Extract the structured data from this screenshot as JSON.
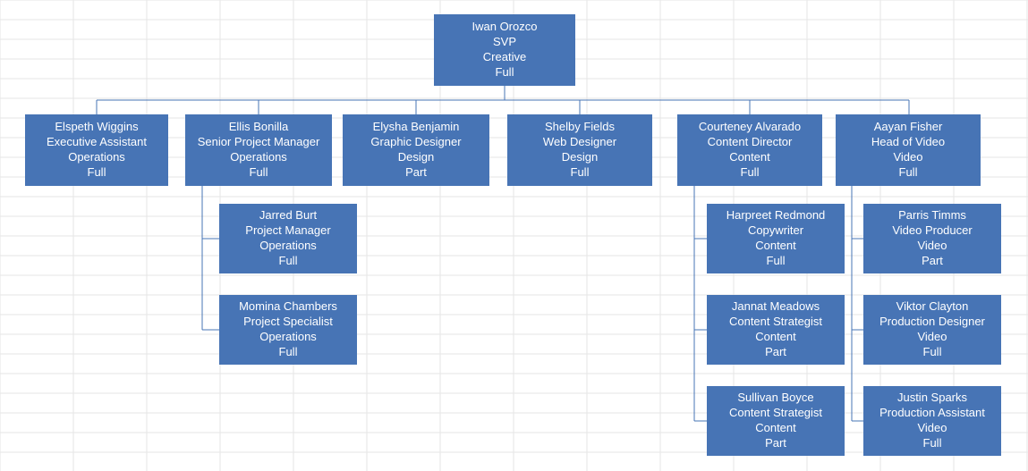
{
  "chart_data": {
    "type": "org-chart",
    "root": {
      "name": "Iwan Orozco",
      "title": "SVP",
      "dept": "Creative",
      "status": "Full",
      "children": [
        {
          "name": "Elspeth Wiggins",
          "title": "Executive Assistant",
          "dept": "Operations",
          "status": "Full"
        },
        {
          "name": "Ellis Bonilla",
          "title": "Senior Project Manager",
          "dept": "Operations",
          "status": "Full",
          "children": [
            {
              "name": "Jarred Burt",
              "title": "Project Manager",
              "dept": "Operations",
              "status": "Full"
            },
            {
              "name": "Momina Chambers",
              "title": "Project Specialist",
              "dept": "Operations",
              "status": "Full"
            }
          ]
        },
        {
          "name": "Elysha Benjamin",
          "title": "Graphic Designer",
          "dept": "Design",
          "status": "Part"
        },
        {
          "name": "Shelby Fields",
          "title": "Web Designer",
          "dept": "Design",
          "status": "Full"
        },
        {
          "name": "Courteney Alvarado",
          "title": "Content Director",
          "dept": "Content",
          "status": "Full",
          "children": [
            {
              "name": "Harpreet Redmond",
              "title": "Copywriter",
              "dept": "Content",
              "status": "Full"
            },
            {
              "name": "Jannat Meadows",
              "title": "Content Strategist",
              "dept": "Content",
              "status": "Part"
            },
            {
              "name": "Sullivan Boyce",
              "title": "Content Strategist",
              "dept": "Content",
              "status": "Part"
            }
          ]
        },
        {
          "name": "Aayan Fisher",
          "title": "Head of Video",
          "dept": "Video",
          "status": "Full",
          "children": [
            {
              "name": "Parris Timms",
              "title": "Video Producer",
              "dept": "Video",
              "status": "Part"
            },
            {
              "name": "Viktor Clayton",
              "title": "Production Designer",
              "dept": "Video",
              "status": "Full"
            },
            {
              "name": "Justin Sparks",
              "title": "Production Assistant",
              "dept": "Video",
              "status": "Full"
            }
          ]
        }
      ]
    }
  }
}
